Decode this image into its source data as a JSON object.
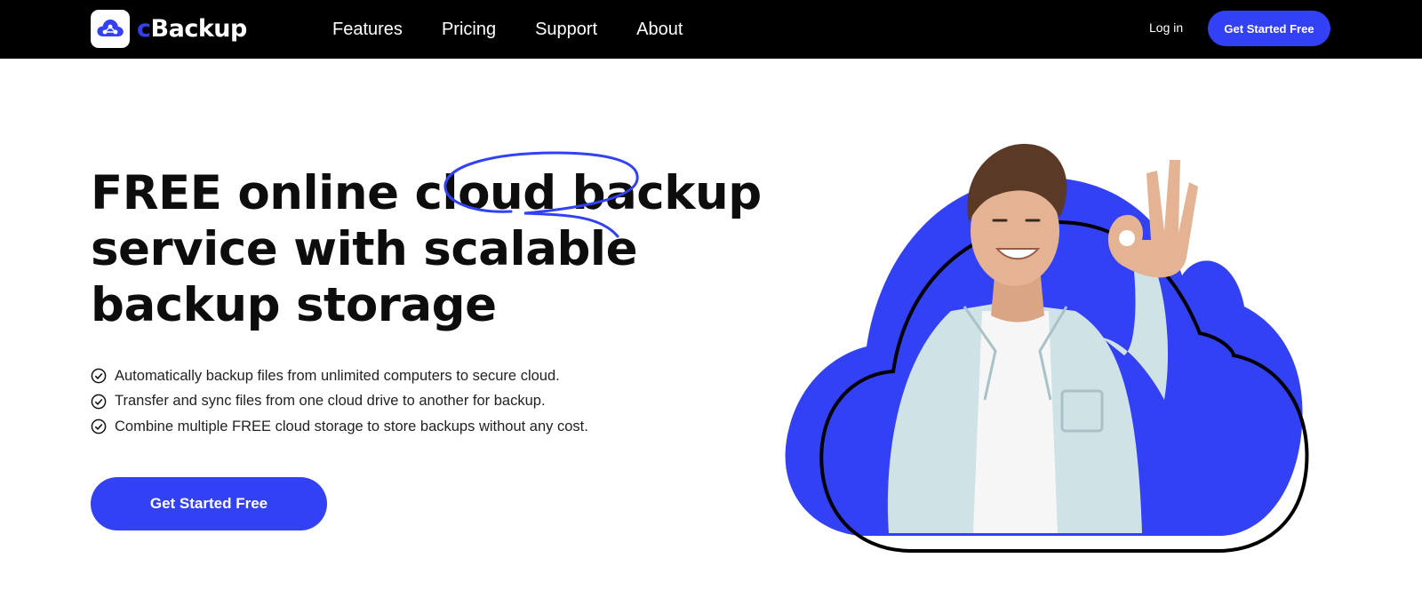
{
  "brand": {
    "name_accent": "c",
    "name_rest": "Backup",
    "icon": "cloud-network-icon",
    "accent_color": "#3341f5"
  },
  "nav": {
    "links": [
      "Features",
      "Pricing",
      "Support",
      "About"
    ],
    "login_label": "Log in",
    "cta_label": "Get Started Free"
  },
  "hero": {
    "headline_lines": [
      "FREE online cloud backup",
      "service with scalable",
      "backup storage"
    ],
    "features": [
      "Automatically backup files from unlimited computers to secure cloud.",
      "Transfer and sync files from one cloud drive to another for backup.",
      "Combine multiple FREE cloud storage to store backups without any cost."
    ],
    "feature_icon": "check-circle-icon",
    "cta_label": "Get Started Free",
    "image": {
      "subject": "smiling man making OK gesture",
      "backdrop": "blue-cloud-shape"
    }
  }
}
